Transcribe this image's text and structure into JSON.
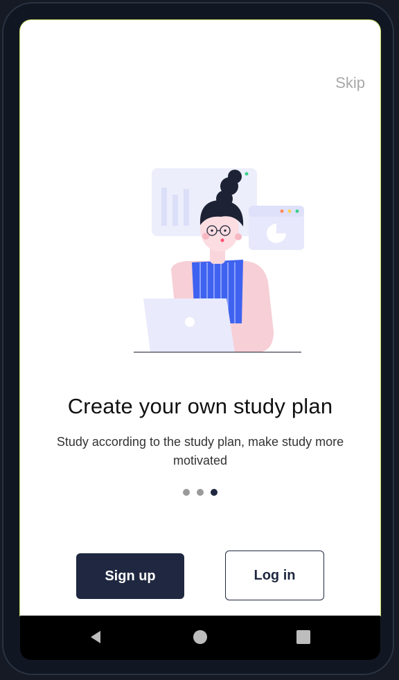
{
  "onboarding": {
    "skip_label": "Skip",
    "title": "Create your own study plan",
    "subtitle": "Study according to the study plan, make study more motivated",
    "pagination": {
      "count": 3,
      "active_index": 2
    },
    "signup_label": "Sign up",
    "login_label": "Log in"
  },
  "colors": {
    "primary": "#1f2840",
    "accent_blue": "#3f63f0",
    "skin_pink": "#f6c9d1",
    "panel_lavender": "#e7e8fb"
  },
  "navbar": {
    "icons": [
      "back-icon",
      "home-icon",
      "recents-icon"
    ]
  }
}
